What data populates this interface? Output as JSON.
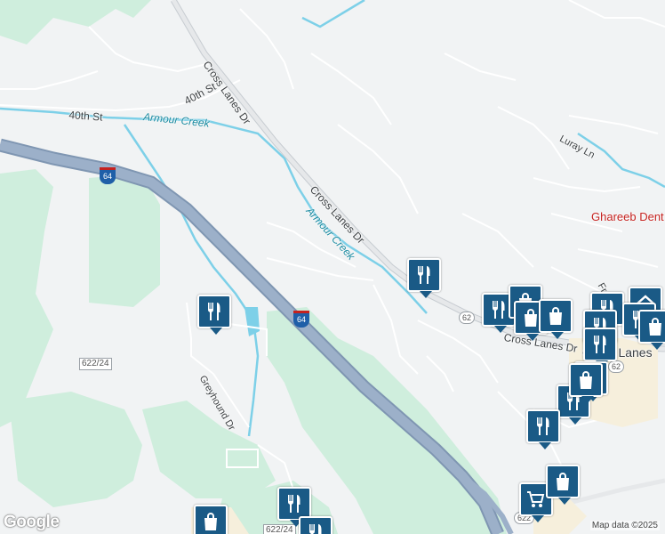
{
  "roads": {
    "cross_lanes_dr_1": "Cross Lanes Dr",
    "cross_lanes_dr_2": "Cross Lanes Dr",
    "cross_lanes_dr_3": "Cross Lanes Dr",
    "fortieth_st_1": "40th St",
    "fortieth_st_2": "40th St",
    "luray_ln": "Luray Ln",
    "greyhound_dr": "Greyhound Dr",
    "fro_partial": "Fro"
  },
  "water": {
    "armour_creek_1": "Armour Creek",
    "armour_creek_2": "Armour Creek"
  },
  "places": {
    "cross_lanes": "Cross Lanes"
  },
  "businesses": {
    "ghareeb": "Ghareeb Dent"
  },
  "route_shields": {
    "i64_a": "64",
    "i64_b": "64",
    "r62_a": "62",
    "r62_b": "62",
    "r622": "622",
    "r622_24_a": "622/24",
    "r622_24_b": "622/24"
  },
  "pins": [
    {
      "type": "restaurant"
    },
    {
      "type": "restaurant"
    },
    {
      "type": "restaurant"
    },
    {
      "type": "shopping"
    },
    {
      "type": "shopping"
    },
    {
      "type": "shopping"
    },
    {
      "type": "restaurant"
    },
    {
      "type": "home"
    },
    {
      "type": "restaurant"
    },
    {
      "type": "restaurant"
    },
    {
      "type": "shopping"
    },
    {
      "type": "restaurant"
    },
    {
      "type": "restaurant"
    },
    {
      "type": "restaurant"
    },
    {
      "type": "shopping"
    },
    {
      "type": "cart"
    },
    {
      "type": "shopping"
    },
    {
      "type": "restaurant"
    },
    {
      "type": "shopping"
    },
    {
      "type": "restaurant"
    },
    {
      "type": "restaurant"
    }
  ],
  "branding": {
    "logo": "Google",
    "attribution": "Map data ©2025"
  },
  "colors": {
    "background": "#f1f3f4",
    "park": "#cfeedd",
    "interstate": "#8fa4bf",
    "water": "#7dd0e8",
    "pin": "#1a5a86"
  }
}
